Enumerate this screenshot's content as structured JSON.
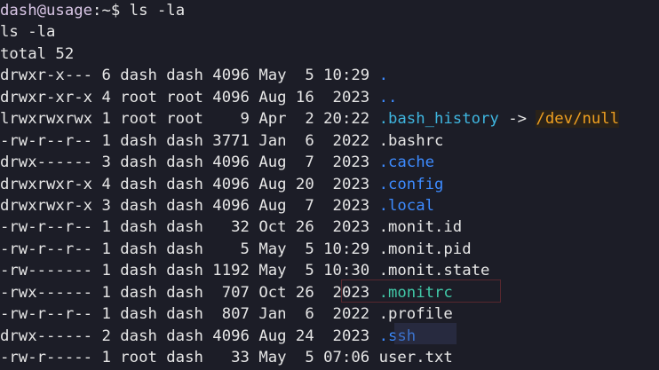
{
  "prompt": {
    "user_host": "dash@usage",
    "path": ":~$",
    "command": " ls -la"
  },
  "echo_command": "ls -la",
  "total_line": "total 52",
  "entries": [
    {
      "meta": "drwxr-x--- 6 dash dash 4096 May  5 10:29 ",
      "name": ".",
      "kind": "dir"
    },
    {
      "meta": "drwxr-xr-x 4 root root 4096 Aug 16  2023 ",
      "name": "..",
      "kind": "dir"
    },
    {
      "meta": "lrwxrwxrwx 1 root root    9 Apr  2 20:22 ",
      "name": ".bash_history",
      "kind": "link",
      "arrow": " -> ",
      "target": "/dev/null"
    },
    {
      "meta": "-rw-r--r-- 1 dash dash 3771 Jan  6  2022 ",
      "name": ".bashrc",
      "kind": "file"
    },
    {
      "meta": "drwx------ 3 dash dash 4096 Aug  7  2023 ",
      "name": ".cache",
      "kind": "dir"
    },
    {
      "meta": "drwxrwxr-x 4 dash dash 4096 Aug 20  2023 ",
      "name": ".config",
      "kind": "dir"
    },
    {
      "meta": "drwxrwxr-x 3 dash dash 4096 Aug  7  2023 ",
      "name": ".local",
      "kind": "dir"
    },
    {
      "meta": "-rw-r--r-- 1 dash dash   32 Oct 26  2023 ",
      "name": ".monit.id",
      "kind": "file"
    },
    {
      "meta": "-rw-r--r-- 1 dash dash    5 May  5 10:29 ",
      "name": ".monit.pid",
      "kind": "file"
    },
    {
      "meta": "-rw------- 1 dash dash 1192 May  5 10:30 ",
      "name": ".monit.state",
      "kind": "file"
    },
    {
      "meta": "-rwx------ 1 dash dash  707 Oct 26  2023 ",
      "name": ".monitrc",
      "kind": "exec"
    },
    {
      "meta": "-rw-r--r-- 1 dash dash  807 Jan  6  2022 ",
      "name": ".profile",
      "kind": "file"
    },
    {
      "meta": "drwx------ 2 dash dash 4096 Aug 24  2023 ",
      "name": ".ssh",
      "kind": "dir"
    },
    {
      "meta": "-rw-r----- 1 root dash   33 May  5 07:06 ",
      "name": "user.txt",
      "kind": "file"
    }
  ],
  "colors": {
    "background": "#1c1d27",
    "text": "#e6e6e6",
    "directory": "#3d8bff",
    "executable": "#41c9a8",
    "symlink": "#3fb6e0",
    "symlink_target_bg": "#f3b41b"
  }
}
